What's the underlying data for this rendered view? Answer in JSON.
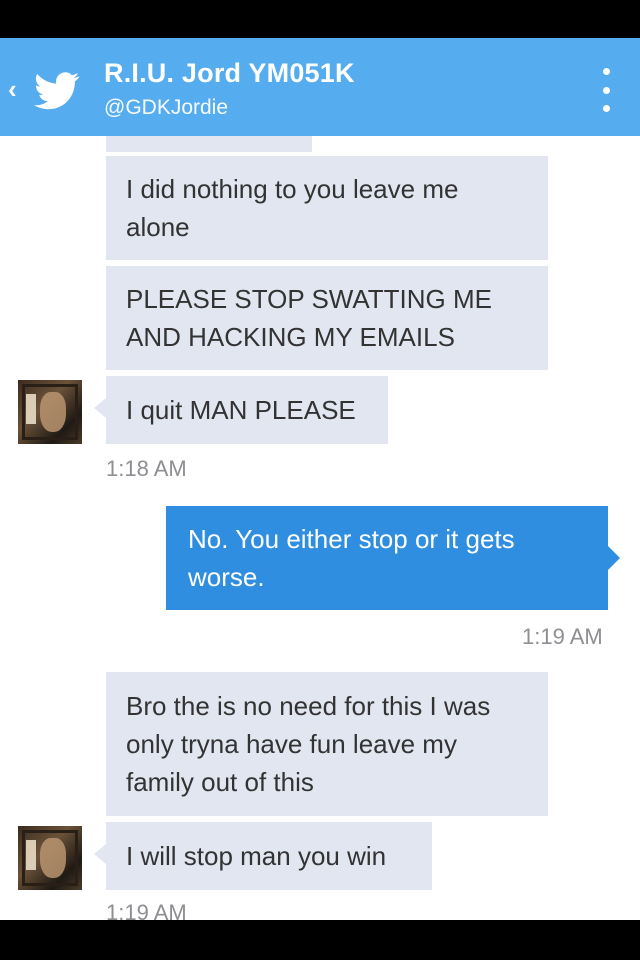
{
  "header": {
    "title": "R.I.U. Jord YM051K",
    "handle": "@GDKJordie",
    "back_icon": "chevron-left-icon",
    "logo_icon": "twitter-bird-icon",
    "menu_icon": "kebab-menu-icon",
    "color": "#55acee"
  },
  "messages": [
    {
      "direction": "incoming",
      "text": "I did nothing to you leave me alone"
    },
    {
      "direction": "incoming",
      "text": "PLEASE STOP SWATTING ME AND HACKING MY EMAILS"
    },
    {
      "direction": "incoming",
      "text": "I quit MAN PLEASE",
      "time": "1:18 AM"
    },
    {
      "direction": "outgoing",
      "text": "No. You either stop or it gets worse.",
      "time": "1:19 AM"
    },
    {
      "direction": "incoming",
      "text": "Bro the is no need for this I was only tryna have fun leave my family out of this"
    },
    {
      "direction": "incoming",
      "text": "I will stop man you win",
      "time": "1:19 AM"
    }
  ],
  "colors": {
    "incoming_bubble": "#e1e6f0",
    "outgoing_bubble": "#2f8ee0",
    "timestamp": "#8e8e93"
  }
}
